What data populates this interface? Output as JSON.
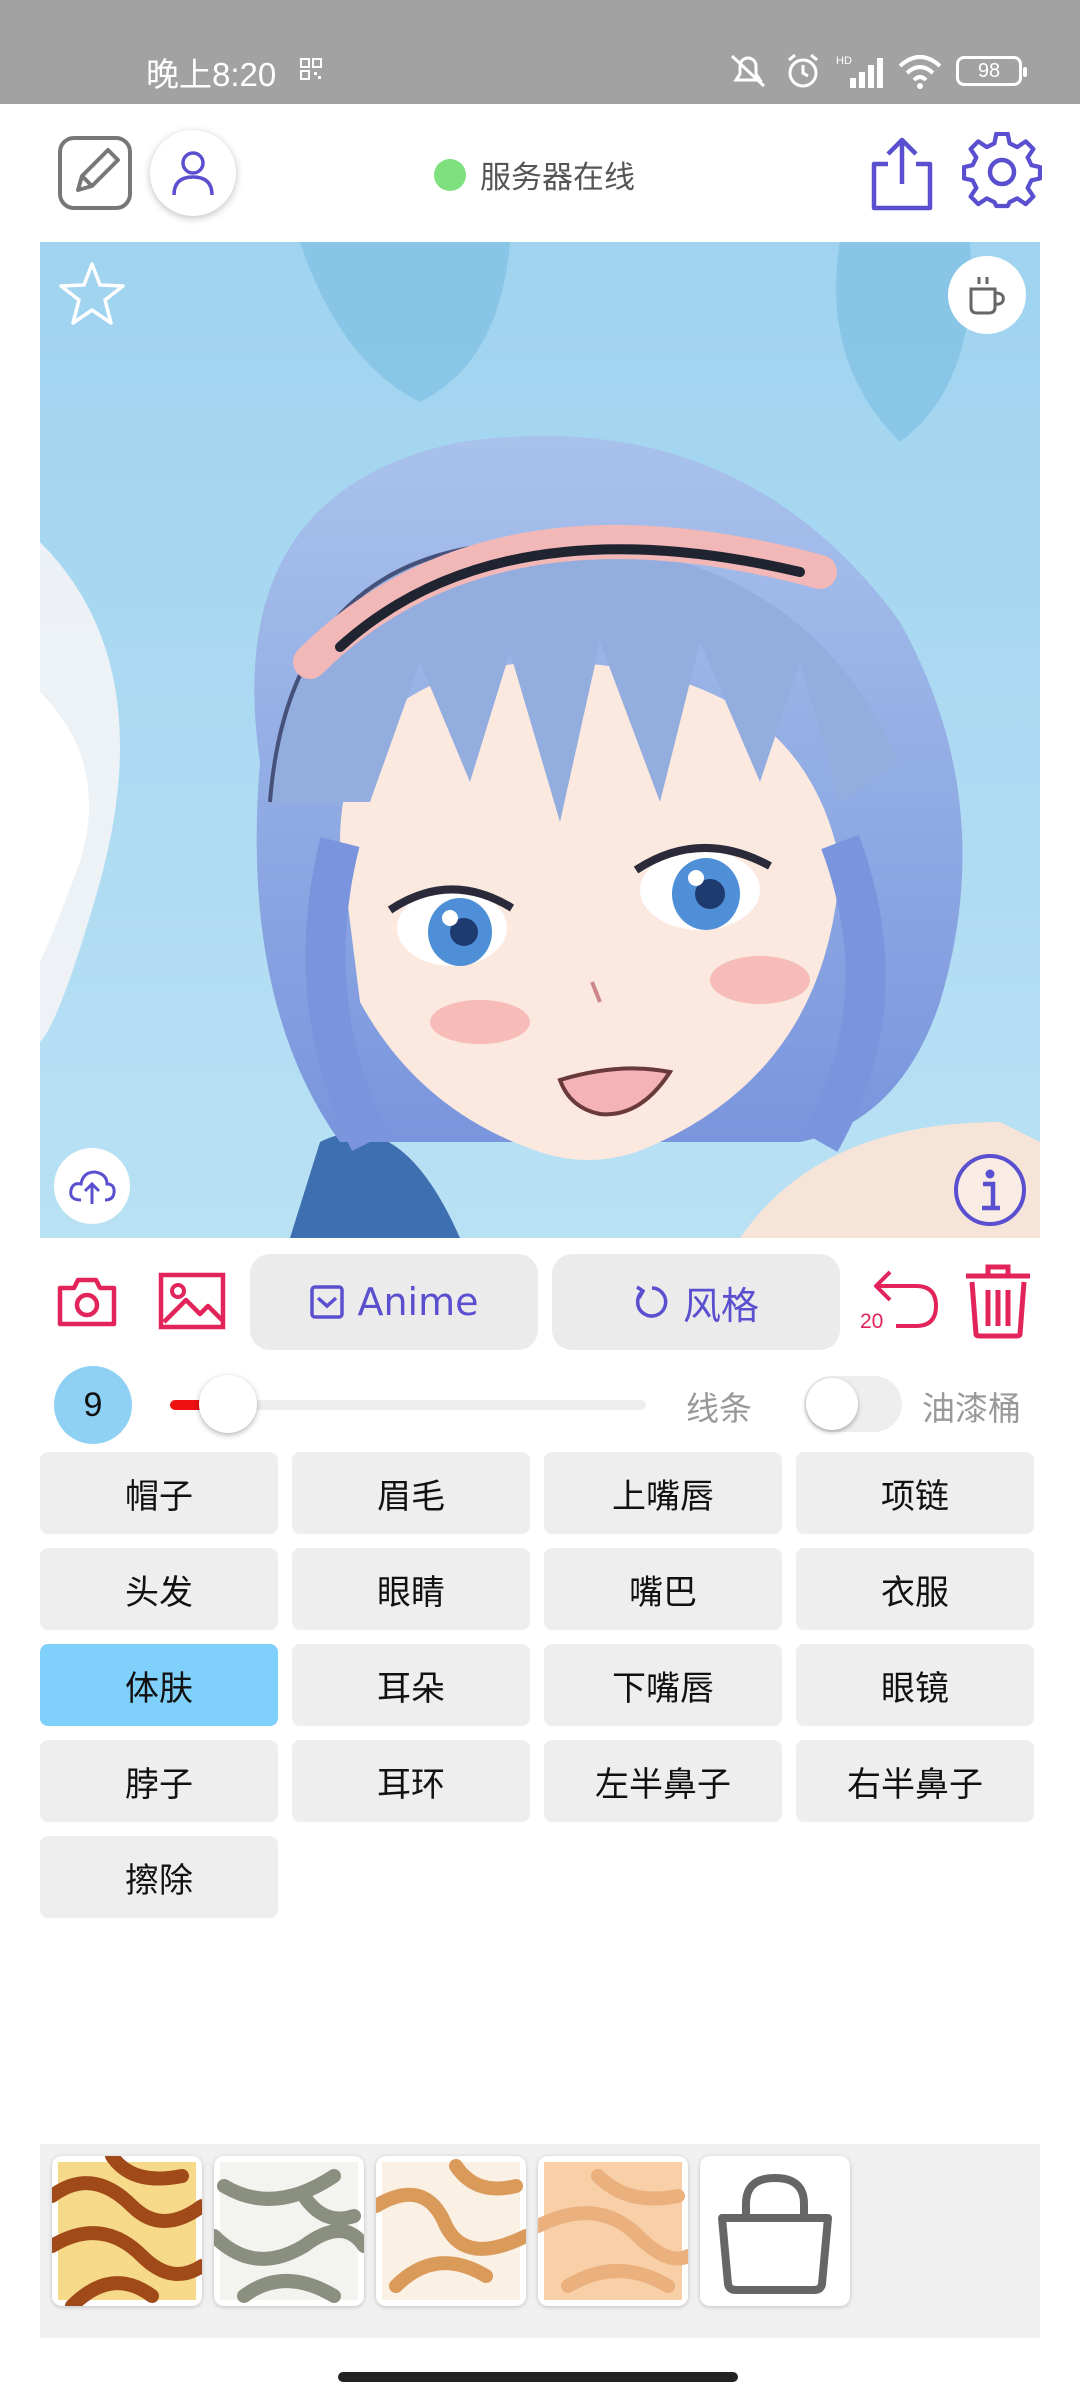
{
  "status_bar": {
    "time": "晚上8:20",
    "battery": "98"
  },
  "header": {
    "server_status": "服务器在线"
  },
  "toolbar": {
    "anime_label": "Anime",
    "style_label": "风格",
    "undo_count": "20"
  },
  "brush": {
    "size": "9",
    "size_fraction": 0.06,
    "lines_label": "线条",
    "bucket_label": "油漆桶",
    "bucket_enabled": false
  },
  "parts": [
    {
      "label": "帽子",
      "active": false
    },
    {
      "label": "眉毛",
      "active": false
    },
    {
      "label": "上嘴唇",
      "active": false
    },
    {
      "label": "项链",
      "active": false
    },
    {
      "label": "头发",
      "active": false
    },
    {
      "label": "眼睛",
      "active": false
    },
    {
      "label": "嘴巴",
      "active": false
    },
    {
      "label": "衣服",
      "active": false
    },
    {
      "label": "体肤",
      "active": true
    },
    {
      "label": "耳朵",
      "active": false
    },
    {
      "label": "下嘴唇",
      "active": false
    },
    {
      "label": "眼镜",
      "active": false
    },
    {
      "label": "脖子",
      "active": false
    },
    {
      "label": "耳环",
      "active": false
    },
    {
      "label": "左半鼻子",
      "active": false
    },
    {
      "label": "右半鼻子",
      "active": false
    },
    {
      "label": "擦除",
      "active": false
    }
  ],
  "textures": [
    {
      "name": "texture-1",
      "base": "#f7d98a",
      "stroke": "#a04a1a"
    },
    {
      "name": "texture-2",
      "base": "#f3f3f0",
      "stroke": "#8a8f80"
    },
    {
      "name": "texture-3",
      "base": "#fbf0e4",
      "stroke": "#d99a5a"
    },
    {
      "name": "texture-4",
      "base": "#f8cfa6",
      "stroke": "#eab07e"
    }
  ],
  "colors": {
    "accent": "#5a4fcf",
    "danger": "#e3245b",
    "active_part": "#7fd0fb",
    "online": "#7ee07e"
  }
}
